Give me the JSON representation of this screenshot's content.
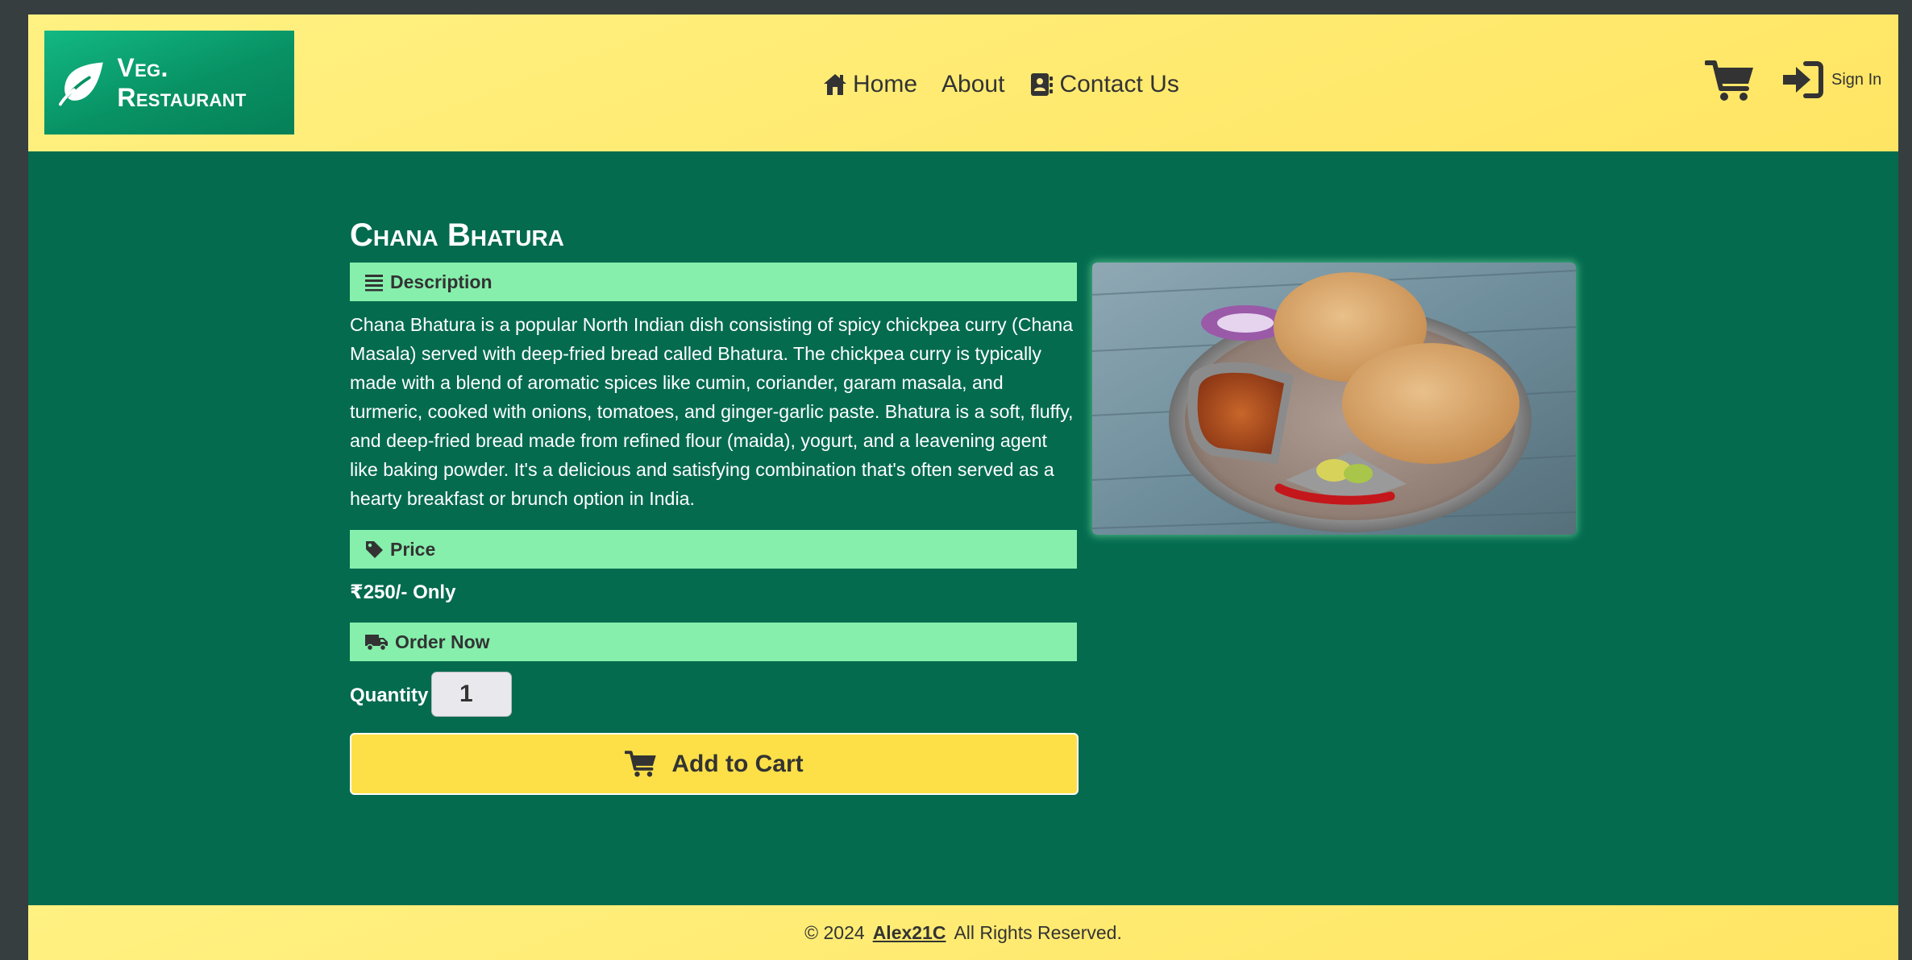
{
  "header": {
    "brand": "Veg. Restaurant",
    "nav": [
      {
        "label": "Home",
        "icon": "home-icon"
      },
      {
        "label": "About",
        "icon": ""
      },
      {
        "label": "Contact Us",
        "icon": "contact-card-icon"
      }
    ],
    "cart_icon": "cart-icon",
    "signin_label": "Sign In"
  },
  "product": {
    "title": "Chana Bhatura",
    "description_heading": "Description",
    "description": "Chana Bhatura is a popular North Indian dish consisting of spicy chickpea curry (Chana Masala) served with deep-fried bread called Bhatura. The chickpea curry is typically made with a blend of aromatic spices like cumin, coriander, garam masala, and turmeric, cooked with onions, tomatoes, and ginger-garlic paste. Bhatura is a soft, fluffy, and deep-fried bread made from refined flour (maida), yogurt, and a leavening agent like baking powder. It's a delicious and satisfying combination that's often served as a hearty breakfast or brunch option in India.",
    "price_heading": "Price",
    "price": "₹250/- Only",
    "order_heading": "Order Now",
    "quantity_label": "Quantity",
    "quantity_value": "1",
    "add_to_cart_label": "Add to Cart"
  },
  "footer": {
    "copyright": "© 2024",
    "author": "Alex21C",
    "rights": "All Rights Reserved."
  },
  "colors": {
    "header_bg": "#ffe563",
    "main_bg": "#046b4f",
    "section_bar": "#86efac",
    "button_bg": "#fde047",
    "logo_bg": "#089264"
  }
}
